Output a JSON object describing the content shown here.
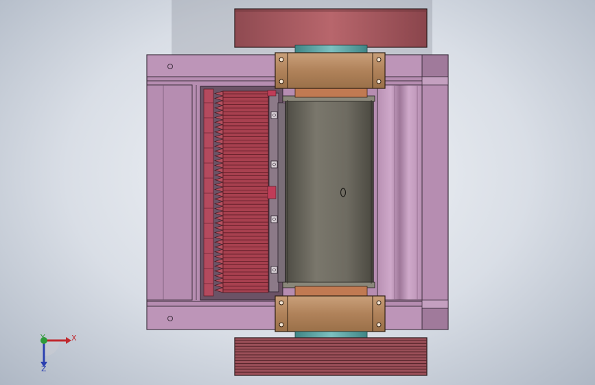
{
  "triad": {
    "x_label": "X",
    "y_label": "Y",
    "z_label": "Z"
  },
  "colors": {
    "background_center": "#f4f6f9",
    "background_edge": "#aeb7c4",
    "frame_pink": "#b98fb4",
    "frame_edge": "#4a3a4a",
    "pulley": "#a65c62",
    "bearing": "#b98a5e",
    "shaft_collar": "#5fa6a6",
    "drum": "#6c6a60",
    "blades": "#a8404f",
    "axis_x": "#c0282d",
    "axis_y": "#2e9a3a",
    "axis_z": "#2a3fb0"
  }
}
